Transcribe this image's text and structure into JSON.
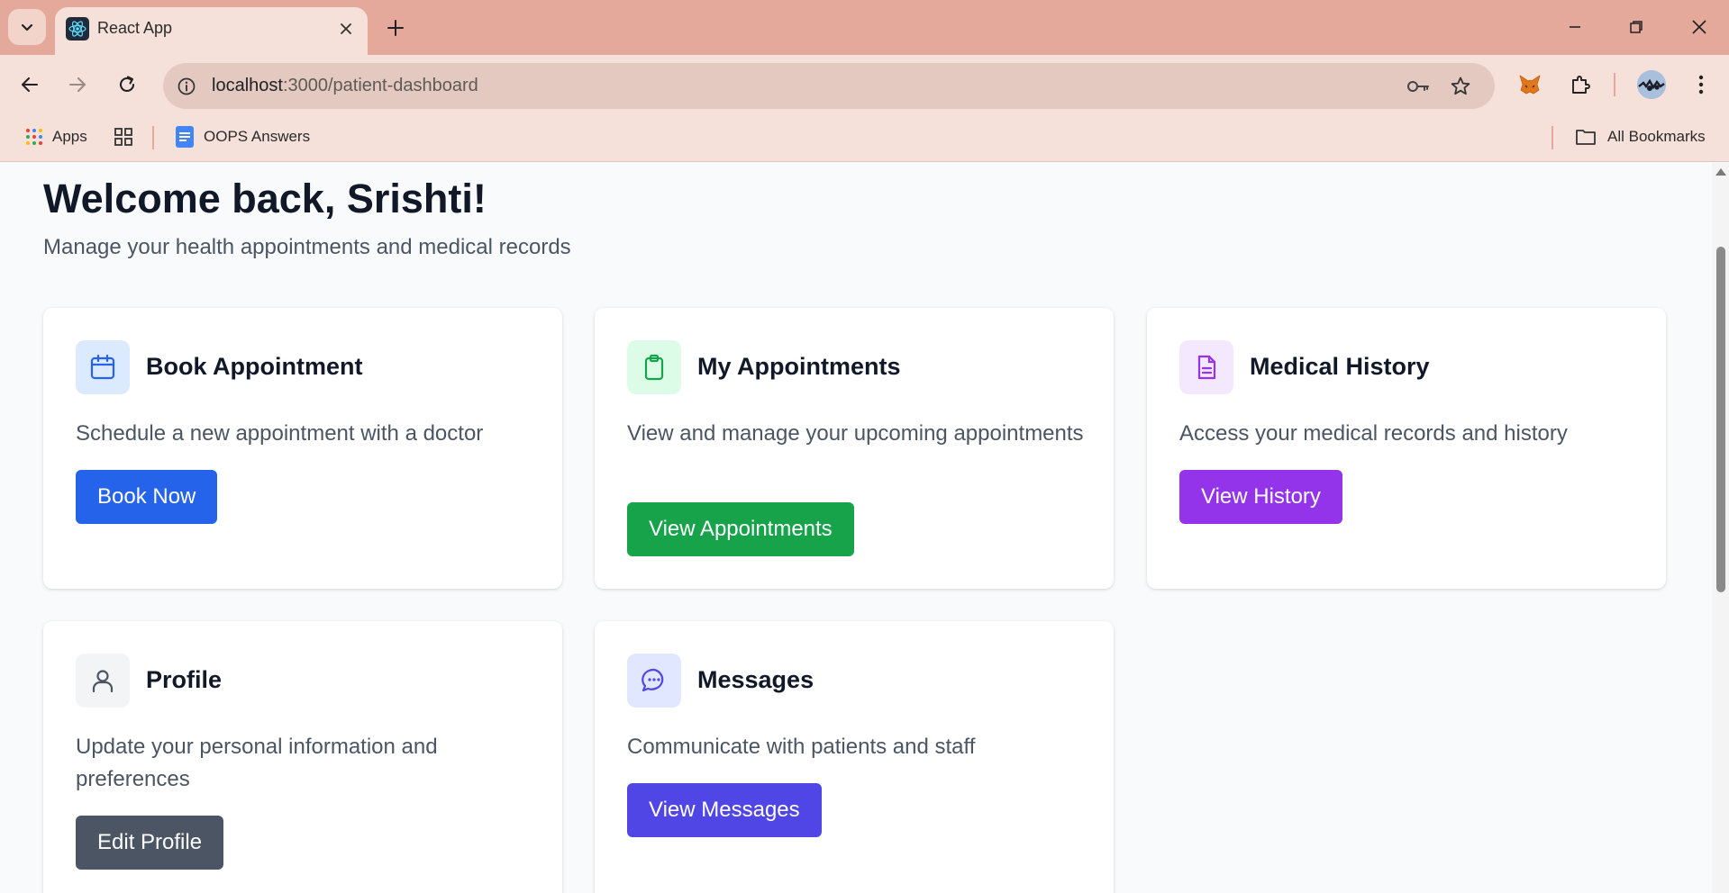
{
  "browser": {
    "tab_title": "React App",
    "url_host": "localhost",
    "url_path": ":3000/patient-dashboard",
    "bookmarks": [
      {
        "label": "Apps",
        "icon": "apps-grid-icon"
      },
      {
        "label": "",
        "icon": "tab-groups-icon"
      },
      {
        "label": "OOPS Answers",
        "icon": "google-docs-icon"
      }
    ],
    "all_bookmarks_label": "All Bookmarks"
  },
  "header": {
    "welcome": "Welcome back, Srishti!",
    "subtitle": "Manage your health appointments and medical records"
  },
  "cards": [
    {
      "title": "Book Appointment",
      "description": "Schedule a new appointment with a doctor",
      "button": "Book Now",
      "icon": "calendar-icon",
      "icon_color": "#2563eb",
      "icon_bg": "#dbeafe",
      "button_color": "#2563eb"
    },
    {
      "title": "My Appointments",
      "description": "View and manage your upcoming appointments",
      "button": "View Appointments",
      "icon": "clipboard-icon",
      "icon_color": "#16a34a",
      "icon_bg": "#dcfce7",
      "button_color": "#16a34a"
    },
    {
      "title": "Medical History",
      "description": "Access your medical records and history",
      "button": "View History",
      "icon": "document-icon",
      "icon_color": "#9333ea",
      "icon_bg": "#f3e8ff",
      "button_color": "#9333ea"
    },
    {
      "title": "Profile",
      "description": "Update your personal information and preferences",
      "button": "Edit Profile",
      "icon": "user-icon",
      "icon_color": "#4b5563",
      "icon_bg": "#f3f4f6",
      "button_color": "#4b5563"
    },
    {
      "title": "Messages",
      "description": "Communicate with patients and staff",
      "button": "View Messages",
      "icon": "chat-icon",
      "icon_color": "#4f46e5",
      "icon_bg": "#e0e7ff",
      "button_color": "#4f46e5"
    }
  ],
  "colors": {
    "tab_strip": "#e4a99a",
    "toolbar": "#f6e0da",
    "page_bg": "#f9fafb"
  }
}
